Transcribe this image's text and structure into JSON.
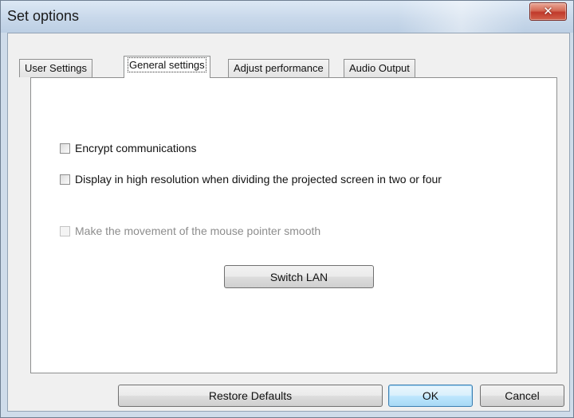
{
  "window": {
    "title": "Set options",
    "close_glyph": "✕"
  },
  "tabs": [
    {
      "label": "User Settings",
      "active": false
    },
    {
      "label": "General settings",
      "active": true
    },
    {
      "label": "Adjust performance",
      "active": false
    },
    {
      "label": "Audio Output",
      "active": false
    }
  ],
  "options": [
    {
      "label": "Encrypt communications",
      "checked": false,
      "enabled": true
    },
    {
      "label": "Display in high resolution when dividing the projected screen in two or four",
      "checked": false,
      "enabled": true
    },
    {
      "label": "Make the movement of the mouse pointer smooth",
      "checked": false,
      "enabled": false
    }
  ],
  "buttons": {
    "switch_lan": "Switch LAN",
    "restore_defaults": "Restore Defaults",
    "ok": "OK",
    "cancel": "Cancel"
  },
  "colors": {
    "frame": "#cfdcea",
    "close_button": "#c0392b",
    "default_button_border": "#3c7fb1"
  },
  "icons": {
    "close": "close-icon"
  }
}
